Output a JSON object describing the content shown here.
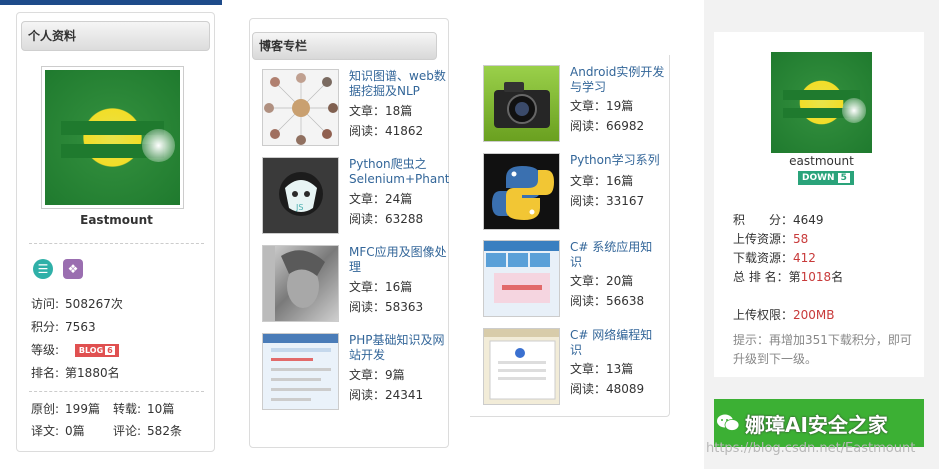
{
  "profile": {
    "title": "个人资料",
    "username": "Eastmount",
    "stats": [
      {
        "label": "访问:",
        "value": "508267次"
      },
      {
        "label": "积分:",
        "value": "7563"
      },
      {
        "label": "等级:",
        "value": ""
      },
      {
        "label": "排名:",
        "value": "第1880名"
      }
    ],
    "level_badge": {
      "text": "BLOG",
      "level": "6"
    },
    "counts": {
      "original_label": "原创:",
      "original_value": "199篇",
      "repost_label": "转载:",
      "repost_value": "10篇",
      "translate_label": "译文:",
      "translate_value": "0篇",
      "comment_label": "评论:",
      "comment_value": "582条"
    },
    "icons": [
      "list-icon",
      "medal-icon"
    ]
  },
  "columns": {
    "title": "博客专栏",
    "left": [
      {
        "name": "知识图谱、web数据挖掘及NLP",
        "articles": "文章：18篇",
        "reads": "阅读：41862"
      },
      {
        "name": "Python爬虫之Selenium+Phanton",
        "articles": "文章：24篇",
        "reads": "阅读：63288"
      },
      {
        "name": "MFC应用及图像处理",
        "articles": "文章：16篇",
        "reads": "阅读：58363"
      },
      {
        "name": "PHP基础知识及网站开发",
        "articles": "文章：9篇",
        "reads": "阅读：24341"
      }
    ],
    "right": [
      {
        "name": "Android实例开发与学习",
        "articles": "文章：19篇",
        "reads": "阅读：66982"
      },
      {
        "name": "Python学习系列",
        "articles": "文章：16篇",
        "reads": "阅读：33167"
      },
      {
        "name": "C# 系统应用知识",
        "articles": "文章：20篇",
        "reads": "阅读：56638"
      },
      {
        "name": "C# 网络编程知识",
        "articles": "文章：13篇",
        "reads": "阅读：48089"
      }
    ]
  },
  "download": {
    "username": "eastmount",
    "badge": {
      "text": "DOWN",
      "level": "5"
    },
    "rows": [
      {
        "label": "积　　分：",
        "value": "4649",
        "red": false
      },
      {
        "label": "上传资源：",
        "value": "58",
        "red": true
      },
      {
        "label": "下载资源：",
        "value": "412",
        "red": true
      },
      {
        "label": "总 排 名：",
        "value_prefix": "第",
        "value": "1018",
        "value_suffix": "名",
        "red": true
      }
    ],
    "upload_limit_label": "上传权限：",
    "upload_limit_value": "200MB",
    "hint": "提示：再增加351下载积分，即可升级到下一级。"
  },
  "watermark": {
    "text": "娜璋AI安全之家",
    "url": "https://blog.csdn.net/Eastmount"
  },
  "colors": {
    "accent_blue": "#336699",
    "red": "#c83a3a",
    "green_badge": "#2aa37a",
    "wm_green": "#3cb034"
  }
}
